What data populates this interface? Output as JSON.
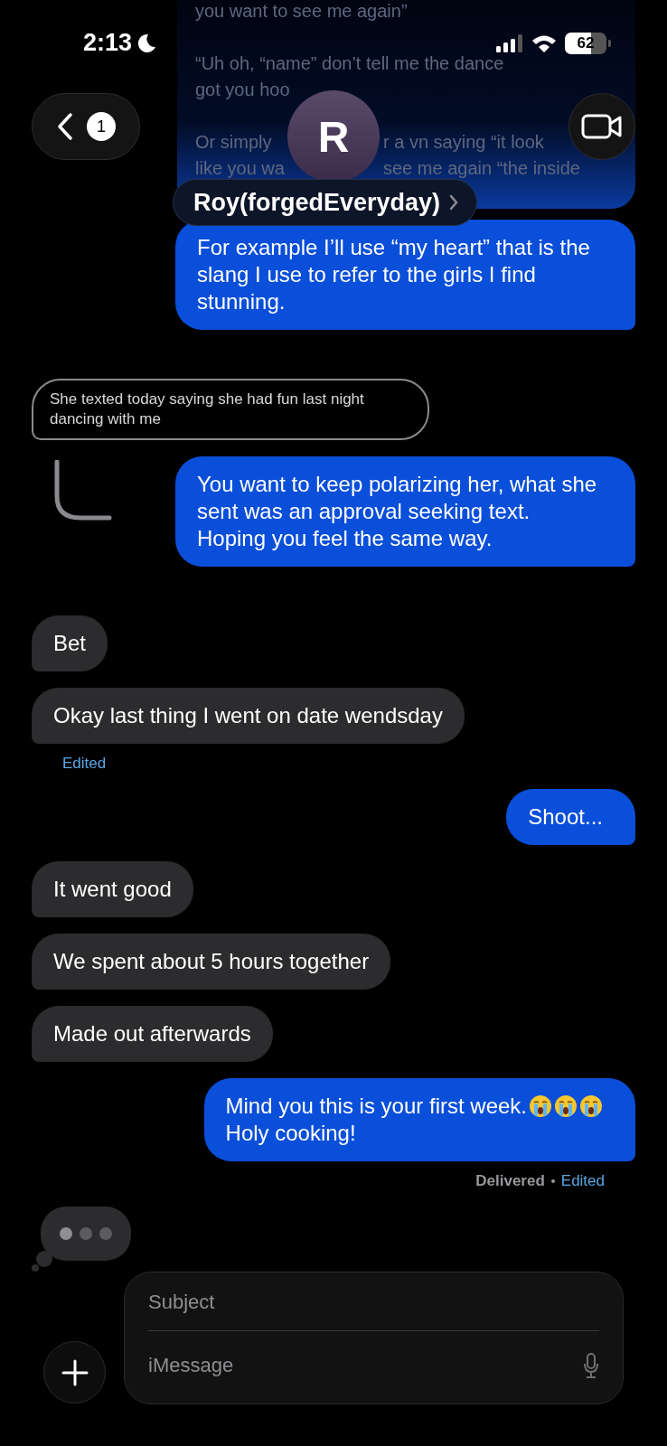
{
  "status_bar": {
    "time": "2:13",
    "battery": {
      "level": 0.62,
      "label": "62"
    }
  },
  "header": {
    "back_badge": "1",
    "avatar_letter": "R",
    "contact_name": "Roy(forgedEveryday)"
  },
  "earlier_message": {
    "paragraphs": [
      {
        "lines": [
          [
            "you want to see me again”"
          ]
        ]
      },
      {
        "lines": [
          [
            "“Uh oh, “name” don’t tell me the dance"
          ],
          [
            "got you hoo"
          ]
        ]
      },
      {
        "lines": [
          [
            "Or simply",
            "r a vn saying “it look"
          ],
          [
            "like you wa",
            "see me again “the inside"
          ]
        ]
      }
    ]
  },
  "groups": [
    {
      "messages": [
        {
          "kind": "sent",
          "text": "For example I’ll use “my heart” that is the slang I use to refer to the girls I find stunning."
        }
      ]
    },
    {
      "messages": [
        {
          "kind": "quote",
          "text": "She texted today saying she had fun last night dancing with me"
        },
        {
          "kind": "sent",
          "reply": true,
          "text": "You want to keep polarizing her, what she sent was an approval seeking text. Hoping you feel the same way."
        }
      ]
    },
    {
      "messages": [
        {
          "kind": "received",
          "text": "Bet"
        },
        {
          "kind": "received",
          "text": "Okay last thing I went on date wendsday",
          "edited": "Edited"
        },
        {
          "kind": "sent",
          "text": "Shoot..."
        },
        {
          "kind": "received",
          "text": "It went good"
        },
        {
          "kind": "received",
          "text": "We spent about 5 hours together"
        },
        {
          "kind": "received",
          "text": "Made out afterwards"
        },
        {
          "kind": "sent",
          "text": "Mind you this is your first week.",
          "emojis": [
            {
              "kind": "crying"
            },
            {
              "kind": "crying"
            },
            {
              "kind": "crying"
            }
          ],
          "text2": "Holy cooking!",
          "delivered": "Delivered",
          "edited": "Edited"
        },
        {
          "kind": "typing"
        }
      ]
    }
  ],
  "composer": {
    "subject_placeholder": "Subject",
    "message_placeholder": "iMessage"
  }
}
